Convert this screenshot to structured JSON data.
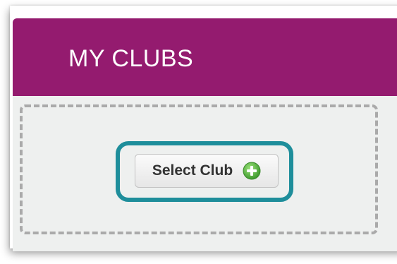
{
  "panel": {
    "title": "MY CLUBS",
    "header_color": "#941b6f"
  },
  "select_club": {
    "label": "Select Club",
    "icon": "plus-circle-icon",
    "highlight_color": "#1e8e9b"
  }
}
